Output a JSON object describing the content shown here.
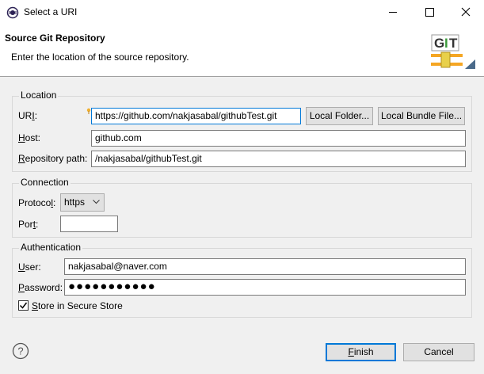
{
  "window": {
    "title": "Select a URI",
    "controls": {
      "minimize": "minimize-icon",
      "maximize": "maximize-icon",
      "close": "close-icon"
    }
  },
  "banner": {
    "title": "Source Git Repository",
    "message": "Enter the location of the source repository.",
    "logo_text": "GIT"
  },
  "location": {
    "group_label": "Location",
    "uri_label_prefix": "UR",
    "uri_label_mnemonic": "I",
    "uri_label_suffix": ":",
    "uri_value": "https://github.com/nakjasabal/githubTest.git",
    "local_folder_button": "Local Folder...",
    "local_bundle_button": "Local Bundle File...",
    "host_label_mnemonic": "H",
    "host_label_rest": "ost:",
    "host_value": "github.com",
    "repo_label_mnemonic": "R",
    "repo_label_rest": "epository path:",
    "repo_value": "/nakjasabal/githubTest.git"
  },
  "connection": {
    "group_label": "Connection",
    "protocol_label_prefix": "Protoco",
    "protocol_label_mnemonic": "l",
    "protocol_label_suffix": ":",
    "protocol_value": "https",
    "port_label_prefix": "Por",
    "port_label_mnemonic": "t",
    "port_label_suffix": ":",
    "port_value": ""
  },
  "authentication": {
    "group_label": "Authentication",
    "user_label_mnemonic": "U",
    "user_label_rest": "ser:",
    "user_value": "nakjasabal@naver.com",
    "password_label_mnemonic": "P",
    "password_label_rest": "assword:",
    "password_value": "●●●●●●●●●●●",
    "store_checked": true,
    "store_label_mnemonic": "S",
    "store_label_rest": "tore in Secure Store"
  },
  "footer": {
    "finish_button_mnemonic": "F",
    "finish_button_rest": "inish",
    "cancel_button": "Cancel"
  },
  "colors": {
    "focus_border": "#0078d7",
    "logo_orange": "#f5a623",
    "logo_green": "#3a9a3a"
  }
}
